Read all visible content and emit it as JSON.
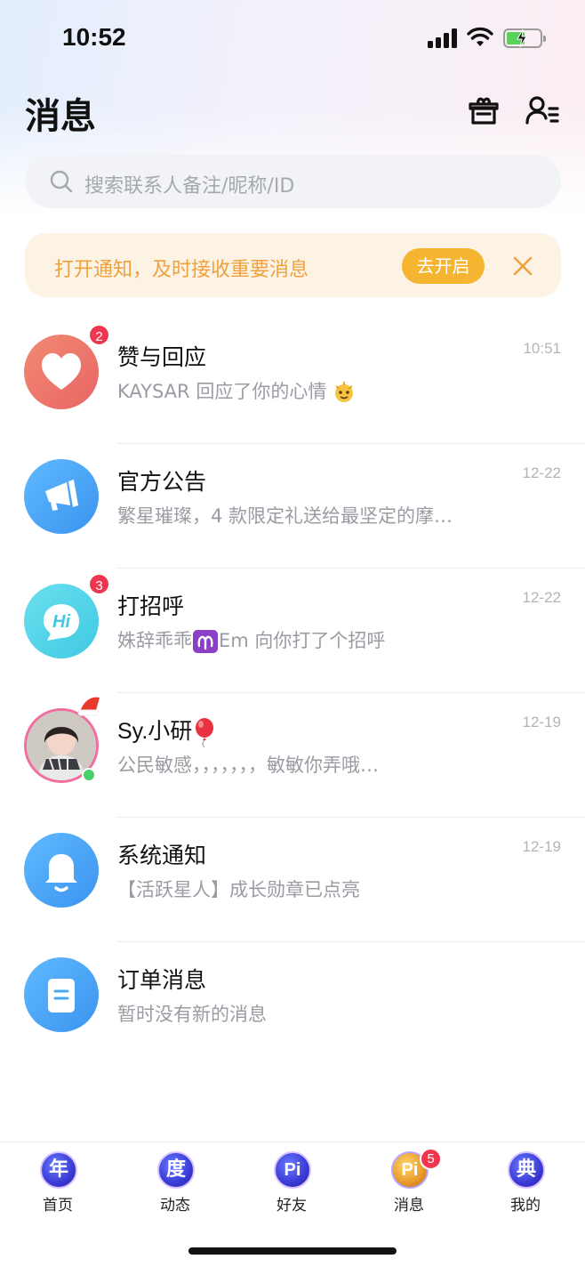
{
  "status_bar": {
    "time": "10:52"
  },
  "header": {
    "title": "消息"
  },
  "search": {
    "placeholder": "搜索联系人备注/昵称/ID"
  },
  "notice": {
    "text": "打开通知，及时接收重要消息",
    "button": "去开启"
  },
  "messages": [
    {
      "title": "赞与回应",
      "subtitle": "KAYSAR 回应了你的心情",
      "time": "10:51",
      "badge": "2",
      "icon": "heart-icon",
      "color": "#ee6f62"
    },
    {
      "title": "官方公告",
      "subtitle": "繁星璀璨，4 款限定礼送给最坚定的摩…",
      "time": "12-22",
      "icon": "megaphone-icon",
      "color": "#4aa8f5"
    },
    {
      "title": "打招呼",
      "subtitle_prefix": "姝辞乖乖",
      "subtitle_suffix": "Em 向你打了个招呼",
      "time": "12-22",
      "badge": "3",
      "icon": "hi-bubble-icon",
      "color": "#58d8ea"
    },
    {
      "title": "Sy.小研",
      "subtitle": "公民敏感，，，，，，，敏敏你弄哦…",
      "time": "12-19",
      "icon": "user-avatar",
      "online": true
    },
    {
      "title": "系统通知",
      "subtitle": "【活跃星人】成长勋章已点亮",
      "time": "12-19",
      "icon": "bell-icon",
      "color": "#4aa8f5"
    },
    {
      "title": "订单消息",
      "subtitle": "暂时没有新的消息",
      "time": "",
      "icon": "clipboard-icon",
      "color": "#4aa8f5"
    }
  ],
  "tabs": [
    {
      "label": "首页",
      "glyph": "年"
    },
    {
      "label": "动态",
      "glyph": "度"
    },
    {
      "label": "好友",
      "glyph": "Pi"
    },
    {
      "label": "消息",
      "glyph": "Pi",
      "badge": "5",
      "active": true
    },
    {
      "label": "我的",
      "glyph": "典"
    }
  ]
}
